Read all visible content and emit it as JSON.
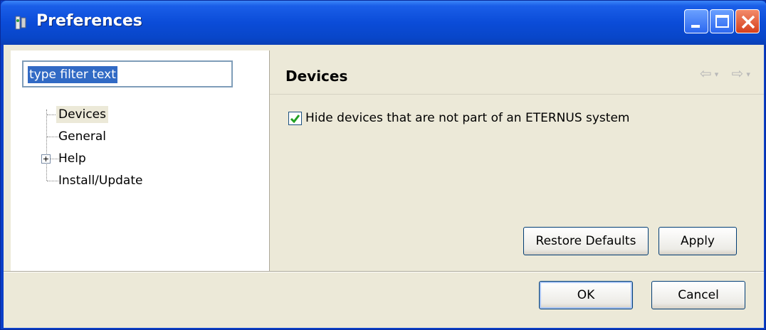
{
  "window": {
    "title": "Preferences"
  },
  "filter": {
    "value": "type filter text"
  },
  "tree": {
    "items": [
      {
        "label": "Devices"
      },
      {
        "label": "General"
      },
      {
        "label": "Help"
      },
      {
        "label": "Install/Update"
      }
    ]
  },
  "page": {
    "title": "Devices",
    "checkbox_label": "Hide devices that are not part of an ETERNUS system",
    "checkbox_checked": true,
    "restore_defaults_label": "Restore Defaults",
    "apply_label": "Apply"
  },
  "dialog": {
    "ok_label": "OK",
    "cancel_label": "Cancel"
  },
  "colors": {
    "titlebar": "#0b4cd8",
    "selection": "#316ac5",
    "checkmark": "#21a121"
  }
}
